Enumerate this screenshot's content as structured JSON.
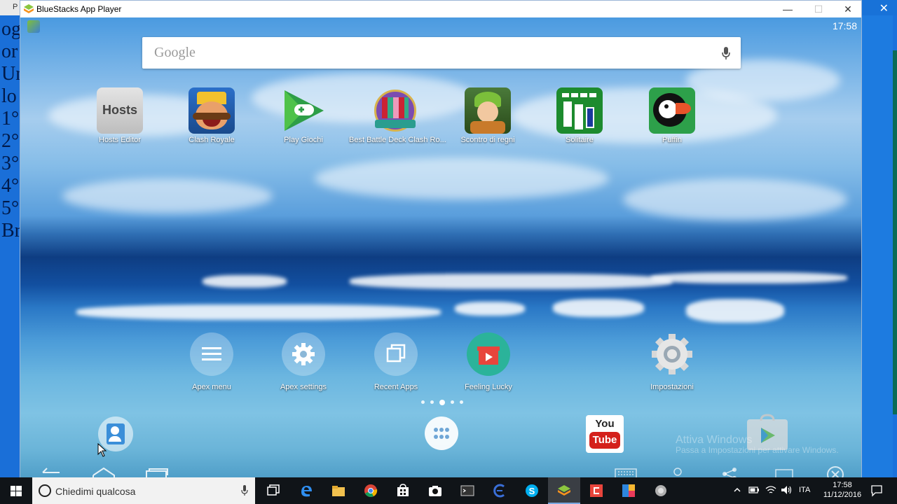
{
  "window": {
    "title": "BlueStacks App Player",
    "controls": {
      "minimize": "—",
      "maximize": "☐",
      "close": "✕"
    }
  },
  "left_document": {
    "top_text": "P",
    "lines": [
      "og",
      "or",
      "Ur",
      "lo",
      "1°",
      "2°",
      "3°",
      "4°",
      "5°",
      "Br"
    ]
  },
  "android": {
    "status_time": "17:58",
    "search": {
      "placeholder": "Google",
      "icon": "mic-icon"
    },
    "apps": [
      {
        "label": "Hosts Editor",
        "icon_text": "Hosts",
        "icon": "hosts-editor-icon"
      },
      {
        "label": "Clash Royale",
        "icon": "clash-royale-icon"
      },
      {
        "label": "Play Giochi",
        "icon": "play-games-icon"
      },
      {
        "label": "Best Battle Deck Clash Ro...",
        "icon": "battle-deck-icon"
      },
      {
        "label": "Scontro di regni",
        "icon": "scontro-di-regni-icon"
      },
      {
        "label": "Solitaire",
        "icon": "solitaire-icon"
      },
      {
        "label": "Puffin",
        "icon": "puffin-icon"
      }
    ],
    "shortcuts": [
      {
        "label": "Apex menu",
        "icon": "menu-icon"
      },
      {
        "label": "Apex settings",
        "icon": "gear-icon"
      },
      {
        "label": "Recent Apps",
        "icon": "recent-apps-icon"
      },
      {
        "label": "Feeling Lucky",
        "icon": "gift-icon"
      },
      {
        "label": "Impostazioni",
        "icon": "settings-gear-icon"
      }
    ],
    "page_indicator": {
      "pages": 5,
      "current": 3
    },
    "dock": [
      {
        "icon": "contacts-icon"
      },
      {
        "icon": "app-drawer-icon"
      },
      {
        "icon": "youtube-icon",
        "text_top": "You",
        "text_bottom": "Tube"
      },
      {
        "icon": "play-store-icon"
      }
    ],
    "watermark": {
      "line1": "Attiva Windows",
      "line2": "Passa a Impostazioni per attivare Windows."
    }
  },
  "taskbar": {
    "search_placeholder": "Chiedimi qualcosa",
    "pinned": [
      "task-view-icon",
      "edge-icon",
      "file-explorer-icon",
      "chrome-icon",
      "store-icon",
      "camera-icon",
      "terminal-icon",
      "eclipse-icon",
      "skype-icon",
      "bluestacks-icon",
      "red-app-icon",
      "photo-app-icon",
      "audio-app-icon"
    ],
    "tray": {
      "language": "ITA",
      "time": "17:58",
      "date": "11/12/2016"
    }
  },
  "colors": {
    "accent": "#1e6ecf",
    "taskbar": "#101418",
    "android_sky": "#7cb6e8",
    "sea": "#124fa0"
  }
}
